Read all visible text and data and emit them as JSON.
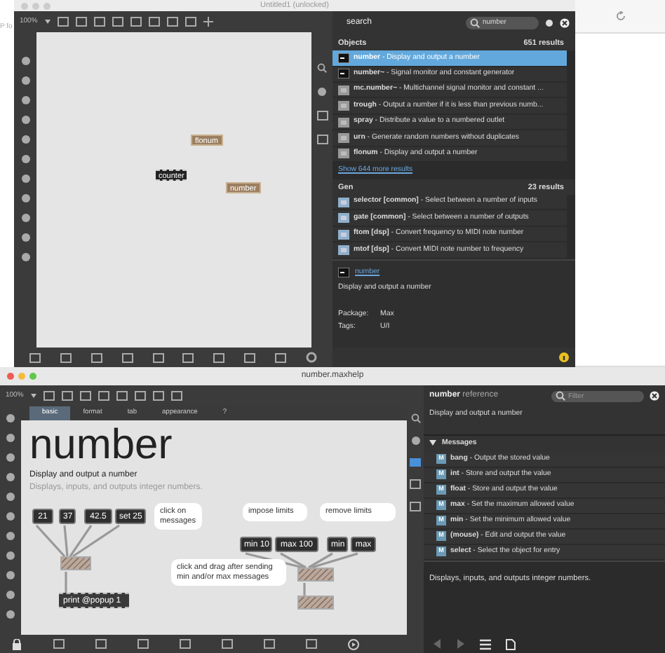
{
  "background": {
    "text": "P fo"
  },
  "editor": {
    "title": "Untitled1 (unlocked)",
    "zoom": "100%",
    "objects": [
      {
        "kind": "ui",
        "text": "flonum"
      },
      {
        "kind": "object",
        "text": "counter"
      },
      {
        "kind": "ui",
        "text": "number"
      }
    ]
  },
  "search": {
    "title": "search",
    "query": "number",
    "sections": [
      {
        "name": "Objects",
        "count": "651 results",
        "more": "Show 644 more results",
        "items": [
          {
            "kind": "ui",
            "text": "**number** - Display and output a number",
            "selected": true
          },
          {
            "kind": "ui",
            "text": "**number~** - Signal monitor and constant generator",
            "selected": false
          },
          {
            "kind": "object",
            "text": "**mc.number~** - Multichannel signal monitor and constant ...",
            "selected": false
          },
          {
            "kind": "object",
            "text": "**trough** - Output a number if it is less than previous numb...",
            "selected": false
          },
          {
            "kind": "object",
            "text": "**spray** - Distribute a value to a numbered outlet",
            "selected": false
          },
          {
            "kind": "object",
            "text": "**urn** - Generate random numbers without duplicates",
            "selected": false
          },
          {
            "kind": "object",
            "text": "**flonum** - Display and output a number",
            "selected": false
          }
        ]
      },
      {
        "name": "Gen",
        "count": "23 results",
        "items": [
          {
            "kind": "gen",
            "text": "**selector [common]** - Select between a number of inputs",
            "selected": false
          },
          {
            "kind": "gen",
            "text": "**gate [common]** - Select between a number of outputs",
            "selected": false
          },
          {
            "kind": "gen",
            "text": "**ftom [dsp]** - Convert frequency to MIDI note number",
            "selected": false
          },
          {
            "kind": "gen",
            "text": "**mtof [dsp]** - Convert MIDI note number to frequency",
            "selected": false
          }
        ]
      }
    ],
    "detail": {
      "name": "number",
      "description": "Display and output a number",
      "fields": [
        {
          "label": "Package:",
          "value": "Max"
        },
        {
          "label": "Tags:",
          "value": "U/I"
        }
      ]
    }
  },
  "help": {
    "title": "number.maxhelp",
    "zoom": "100%",
    "tabs": [
      {
        "label": "basic",
        "selected": true
      },
      {
        "label": "format",
        "selected": false
      },
      {
        "label": "tab",
        "selected": false
      },
      {
        "label": "appearance",
        "selected": false
      },
      {
        "label": "?",
        "selected": false
      }
    ],
    "heading": "number",
    "subtitle": "Display and output a number",
    "description": "Displays, inputs, and outputs integer numbers.",
    "patch": [
      {
        "kind": "message",
        "text": "21"
      },
      {
        "kind": "message",
        "text": "37"
      },
      {
        "kind": "message",
        "text": "42.5"
      },
      {
        "kind": "message",
        "text": "set 25"
      },
      {
        "kind": "comment",
        "text": "click on messages"
      },
      {
        "kind": "number"
      },
      {
        "kind": "object",
        "text": "print @popup 1"
      },
      {
        "kind": "comment",
        "text": "impose limits"
      },
      {
        "kind": "comment",
        "text": "remove limits"
      },
      {
        "kind": "message",
        "text": "min 10"
      },
      {
        "kind": "message",
        "text": "max 100"
      },
      {
        "kind": "message",
        "text": "min"
      },
      {
        "kind": "message",
        "text": "max"
      },
      {
        "kind": "comment",
        "text": "click and drag after sending min and/or max messages"
      },
      {
        "kind": "number"
      },
      {
        "kind": "number"
      }
    ]
  },
  "reference": {
    "name": "number",
    "suffix": "reference",
    "filter_placeholder": "Filter",
    "summary": "Display and output a number",
    "section": {
      "name": "Messages",
      "expanded": true,
      "items": [
        {
          "badge": "M",
          "text": "**bang** - Output the stored value"
        },
        {
          "badge": "M",
          "text": "**int** - Store and output the value"
        },
        {
          "badge": "M",
          "text": "**float** - Store and output the value"
        },
        {
          "badge": "M",
          "text": "**max** - Set the maximum allowed value"
        },
        {
          "badge": "M",
          "text": "**min** - Set the minimum allowed value"
        },
        {
          "badge": "M",
          "text": "**(mouse)** - Edit and output the value"
        },
        {
          "badge": "M",
          "text": "**select** - Select the object for entry"
        }
      ]
    },
    "footer": "Displays, inputs, and outputs integer numbers."
  }
}
